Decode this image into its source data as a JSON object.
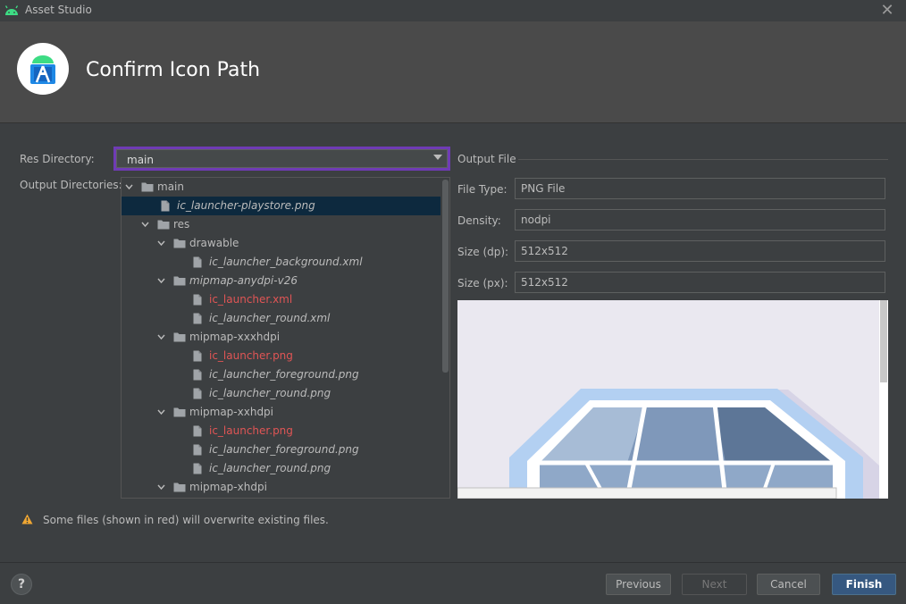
{
  "window": {
    "title": "Asset Studio",
    "close_glyph": "✕"
  },
  "header": {
    "heading": "Confirm Icon Path",
    "logo_icon": "android-studio-icon"
  },
  "form": {
    "res_directory_label": "Res Directory:",
    "res_directory_value": "main",
    "output_directories_label": "Output Directories:"
  },
  "tree": {
    "items": [
      {
        "label": "main",
        "kind": "folder",
        "depth": 0,
        "expanded": true
      },
      {
        "label": "ic_launcher-playstore.png",
        "kind": "file",
        "depth": 1,
        "selected": true
      },
      {
        "label": "res",
        "kind": "folder",
        "depth": 1,
        "expanded": true
      },
      {
        "label": "drawable",
        "kind": "folder",
        "depth": 2,
        "expanded": true
      },
      {
        "label": "ic_launcher_background.xml",
        "kind": "file",
        "depth": 3
      },
      {
        "label": "mipmap-anydpi-v26",
        "kind": "folder",
        "depth": 2,
        "expanded": true,
        "italic": true
      },
      {
        "label": "ic_launcher.xml",
        "kind": "file",
        "depth": 3,
        "overwrite": true
      },
      {
        "label": "ic_launcher_round.xml",
        "kind": "file",
        "depth": 3
      },
      {
        "label": "mipmap-xxxhdpi",
        "kind": "folder",
        "depth": 2,
        "expanded": true
      },
      {
        "label": "ic_launcher.png",
        "kind": "file",
        "depth": 3,
        "overwrite": true
      },
      {
        "label": "ic_launcher_foreground.png",
        "kind": "file",
        "depth": 3
      },
      {
        "label": "ic_launcher_round.png",
        "kind": "file",
        "depth": 3
      },
      {
        "label": "mipmap-xxhdpi",
        "kind": "folder",
        "depth": 2,
        "expanded": true
      },
      {
        "label": "ic_launcher.png",
        "kind": "file",
        "depth": 3,
        "overwrite": true
      },
      {
        "label": "ic_launcher_foreground.png",
        "kind": "file",
        "depth": 3
      },
      {
        "label": "ic_launcher_round.png",
        "kind": "file",
        "depth": 3
      },
      {
        "label": "mipmap-xhdpi",
        "kind": "folder",
        "depth": 2,
        "expanded": true
      }
    ]
  },
  "output_file": {
    "section_title": "Output File",
    "file_type_label": "File Type:",
    "file_type_value": "PNG File",
    "density_label": "Density:",
    "density_value": "nodpi",
    "size_dp_label": "Size (dp):",
    "size_dp_value": "512x512",
    "size_px_label": "Size (px):",
    "size_px_value": "512x512"
  },
  "warning": {
    "icon": "warning-icon",
    "text": "Some files (shown in red) will overwrite existing files."
  },
  "footer": {
    "help_label": "?",
    "previous_label": "Previous",
    "next_label": "Next",
    "cancel_label": "Cancel",
    "finish_label": "Finish"
  },
  "colors": {
    "accent_focus": "#6f3bb5",
    "overwrite_red": "#e05555",
    "primary_button": "#365880",
    "selection": "#0d293e"
  }
}
